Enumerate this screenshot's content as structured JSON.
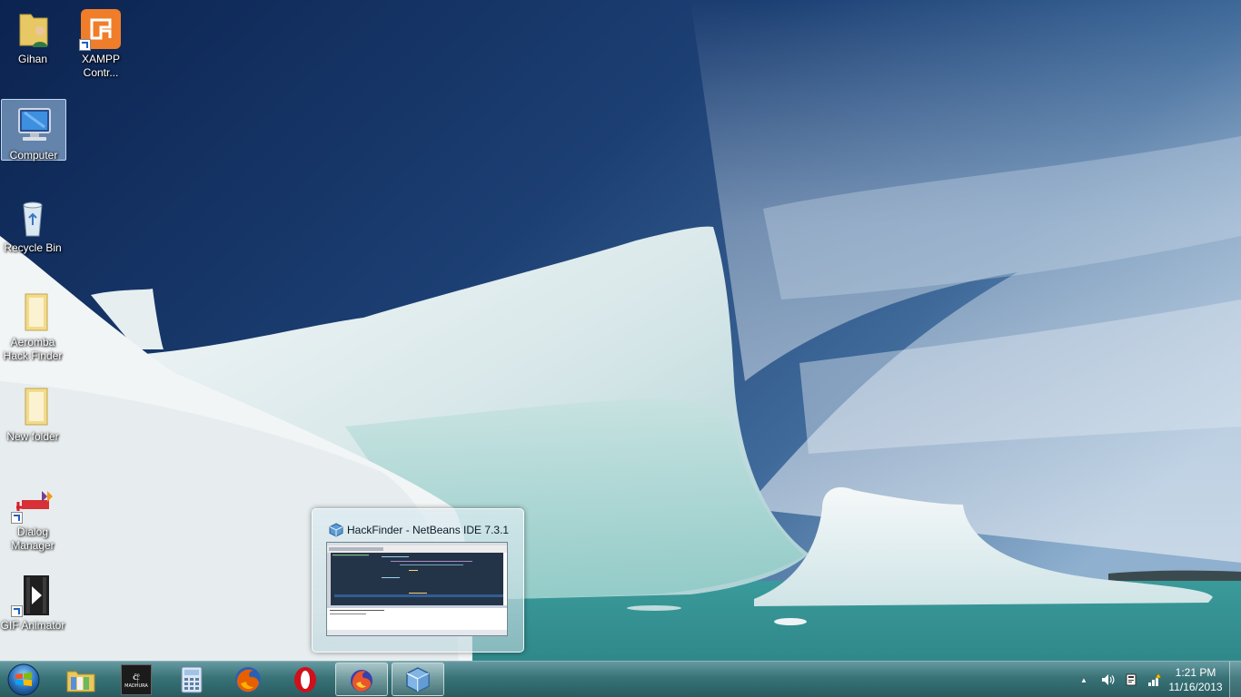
{
  "desktop": {
    "icons": [
      {
        "label": "Gihan",
        "icon": "user-folder-icon"
      },
      {
        "label": "XAMPP Contr...",
        "icon": "xampp-icon"
      },
      {
        "label": "Computer",
        "icon": "computer-icon"
      },
      {
        "label": "Recycle Bin",
        "icon": "recycle-bin-icon"
      },
      {
        "label": "Aeromba Hack Finder",
        "icon": "folder-icon"
      },
      {
        "label": "New folder",
        "icon": "folder-icon"
      },
      {
        "label": "Dialog Manager",
        "icon": "dialog-icon"
      },
      {
        "label": "GIF Animator",
        "icon": "gif-animator-icon"
      }
    ]
  },
  "preview": {
    "title": "HackFinder - NetBeans IDE 7.3.1"
  },
  "taskbar": {
    "buttons": [
      {
        "name": "windows-explorer",
        "icon": "folder-library-icon"
      },
      {
        "name": "dialog-madhura",
        "icon": "madhura-icon",
        "text": "MADHURA"
      },
      {
        "name": "calculator",
        "icon": "calculator-icon"
      },
      {
        "name": "firefox",
        "icon": "firefox-icon"
      },
      {
        "name": "opera",
        "icon": "opera-icon"
      },
      {
        "name": "firefox-nightly",
        "icon": "firefox-nightly-icon"
      },
      {
        "name": "netbeans",
        "icon": "netbeans-cube-icon"
      }
    ],
    "clock": {
      "time": "1:21 PM",
      "date": "11/16/2013"
    },
    "tray_arrow": "▲"
  },
  "colors": {
    "taskbar": "#3c6e73",
    "sky": "#1c3f73",
    "water": "#3fa6a2"
  }
}
